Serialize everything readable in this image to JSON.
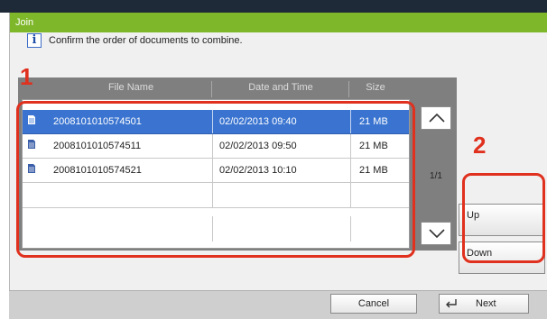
{
  "window": {
    "title": "Join"
  },
  "instruction": {
    "icon": "info-icon",
    "text": "Confirm the order of documents to combine."
  },
  "table": {
    "columns": [
      "File Name",
      "Date and Time",
      "Size"
    ],
    "rows": [
      {
        "name": "2008101010574501",
        "date": "02/02/2013  09:40",
        "size": "21 MB",
        "selected": true
      },
      {
        "name": "2008101010574511",
        "date": "02/02/2013  09:50",
        "size": "21 MB",
        "selected": false
      },
      {
        "name": "2008101010574521",
        "date": "02/02/2013  10:10",
        "size": "21 MB",
        "selected": false
      }
    ]
  },
  "pager": {
    "label": "1/1"
  },
  "buttons": {
    "up": "Up",
    "down": "Down",
    "cancel": "Cancel",
    "next": "Next"
  },
  "callouts": {
    "one": "1",
    "two": "2"
  },
  "colors": {
    "title_bar": "#7fb72a",
    "selection": "#3a74d0",
    "callout": "#e0301e"
  }
}
